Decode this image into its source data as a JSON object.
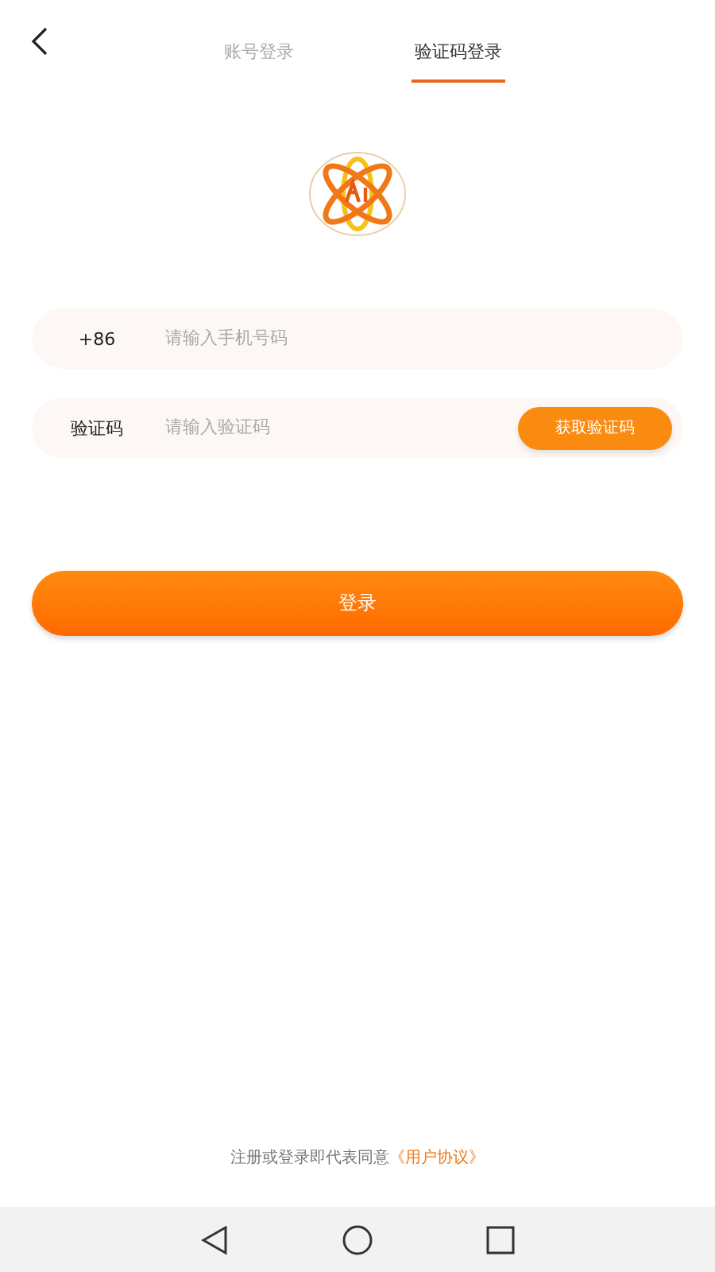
{
  "tabs": [
    {
      "label": "账号登录",
      "selected": false
    },
    {
      "label": "验证码登录",
      "selected": true
    }
  ],
  "phone": {
    "prefix": "+86",
    "placeholder": "请输入手机号码"
  },
  "code": {
    "label": "验证码",
    "placeholder": "请输入验证码",
    "button": "获取验证码"
  },
  "login_button": "登录",
  "agreement": {
    "text": "注册或登录即代表同意",
    "link": "《用户协议》"
  }
}
